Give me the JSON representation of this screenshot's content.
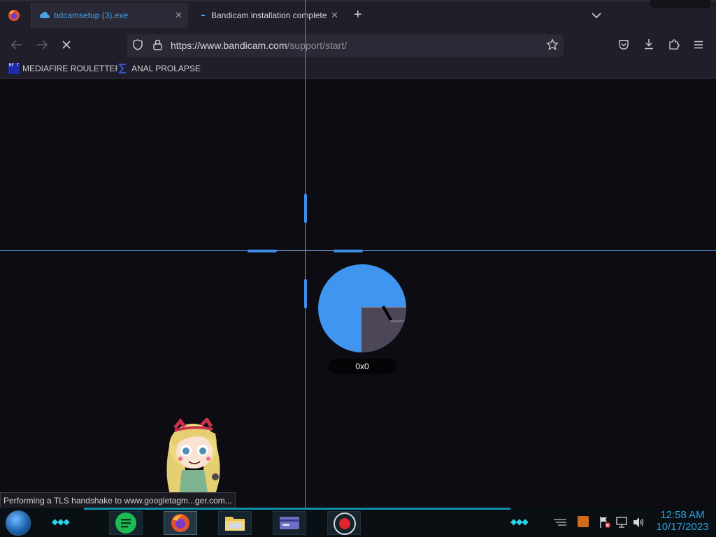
{
  "browser": {
    "tabs": [
      {
        "label": "bdcamsetup (3).exe",
        "active": true
      },
      {
        "label": "Bandicam installation complete",
        "active": false
      }
    ],
    "new_tab_symbol": "+",
    "close_symbol": "✕",
    "url_host": "https://www.bandicam.com",
    "url_path": "/support/start/",
    "bookmarks": [
      {
        "label": "MEDIAFIRE ROULETTER",
        "icon_text": "MF T"
      },
      {
        "label": "ANAL PROLAPSE"
      }
    ],
    "status_text": "Performing a TLS handshake to www.googletagm...ger.com..."
  },
  "capture": {
    "size_label": "0x0"
  },
  "taskbar": {
    "time": "12:58 AM",
    "date": "10/17/2023"
  },
  "colors": {
    "accent": "#4c8fe0",
    "magnifier": "#3f95f0",
    "tab_link": "#4aa3e8",
    "clock": "#2aa2d8",
    "taskbar_chevron": "#27d6e8"
  }
}
